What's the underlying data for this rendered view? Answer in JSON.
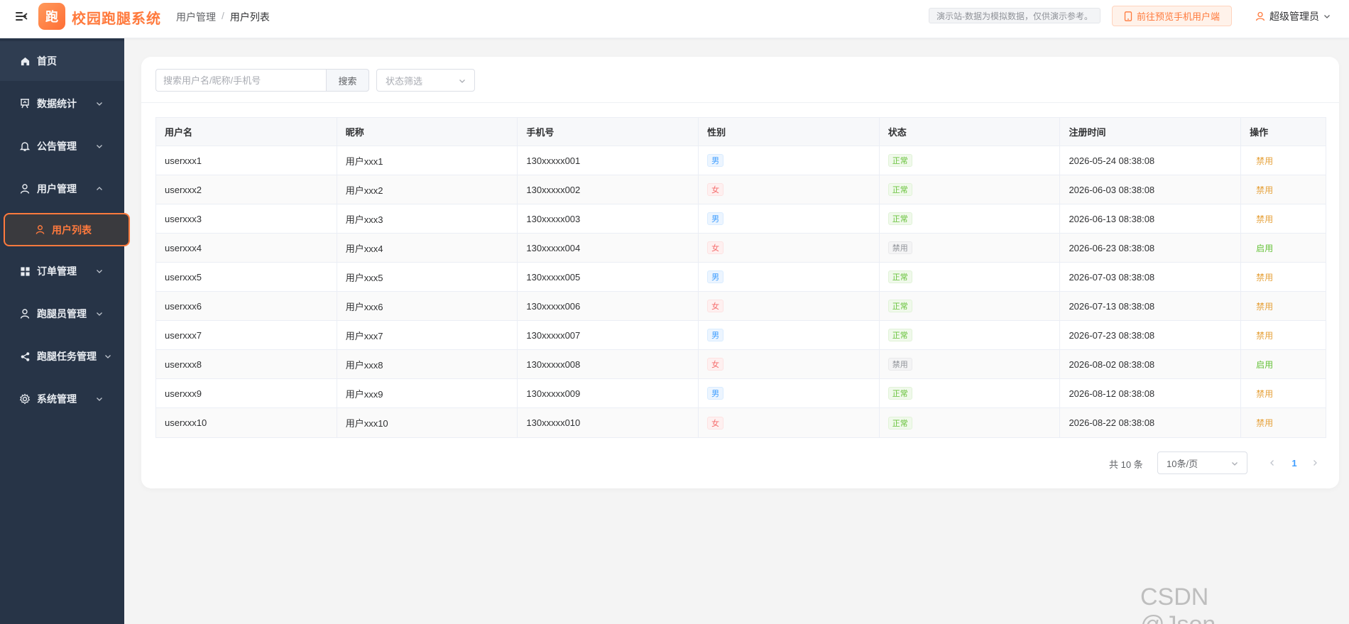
{
  "header": {
    "logo_char": "跑",
    "app_title": "校园跑腿系统",
    "breadcrumb": [
      "用户管理",
      "用户列表"
    ],
    "breadcrumb_sep": "/",
    "notice": "演示站-数据为模拟数据，仅供演示参考。",
    "preview_button": "前往预览手机用户端",
    "user_label": "超级管理员"
  },
  "sidebar": {
    "items": [
      {
        "label": "首页",
        "icon": "home-icon"
      },
      {
        "label": "数据统计",
        "icon": "chart-board-icon"
      },
      {
        "label": "公告管理",
        "icon": "bell-icon"
      },
      {
        "label": "用户管理",
        "icon": "user-icon"
      },
      {
        "label": "订单管理",
        "icon": "grid-icon"
      },
      {
        "label": "跑腿员管理",
        "icon": "user-icon"
      },
      {
        "label": "跑腿任务管理",
        "icon": "share-icon"
      },
      {
        "label": "系统管理",
        "icon": "gear-icon"
      }
    ],
    "active_sub": {
      "label": "用户列表",
      "icon": "user-icon"
    }
  },
  "toolbar": {
    "search_placeholder": "搜索用户名/昵称/手机号",
    "search_button": "搜索",
    "status_placeholder": "状态筛选"
  },
  "table": {
    "columns": [
      "用户名",
      "昵称",
      "手机号",
      "性别",
      "状态",
      "注册时间",
      "操作"
    ],
    "rows": [
      {
        "username": "userxxx1",
        "nickname": "用户xxx1",
        "phone": "130xxxxx001",
        "gender": "男",
        "status": "正常",
        "registered": "2026-05-24 08:38:08",
        "action": "禁用"
      },
      {
        "username": "userxxx2",
        "nickname": "用户xxx2",
        "phone": "130xxxxx002",
        "gender": "女",
        "status": "正常",
        "registered": "2026-06-03 08:38:08",
        "action": "禁用"
      },
      {
        "username": "userxxx3",
        "nickname": "用户xxx3",
        "phone": "130xxxxx003",
        "gender": "男",
        "status": "正常",
        "registered": "2026-06-13 08:38:08",
        "action": "禁用"
      },
      {
        "username": "userxxx4",
        "nickname": "用户xxx4",
        "phone": "130xxxxx004",
        "gender": "女",
        "status": "禁用",
        "registered": "2026-06-23 08:38:08",
        "action": "启用"
      },
      {
        "username": "userxxx5",
        "nickname": "用户xxx5",
        "phone": "130xxxxx005",
        "gender": "男",
        "status": "正常",
        "registered": "2026-07-03 08:38:08",
        "action": "禁用"
      },
      {
        "username": "userxxx6",
        "nickname": "用户xxx6",
        "phone": "130xxxxx006",
        "gender": "女",
        "status": "正常",
        "registered": "2026-07-13 08:38:08",
        "action": "禁用"
      },
      {
        "username": "userxxx7",
        "nickname": "用户xxx7",
        "phone": "130xxxxx007",
        "gender": "男",
        "status": "正常",
        "registered": "2026-07-23 08:38:08",
        "action": "禁用"
      },
      {
        "username": "userxxx8",
        "nickname": "用户xxx8",
        "phone": "130xxxxx008",
        "gender": "女",
        "status": "禁用",
        "registered": "2026-08-02 08:38:08",
        "action": "启用"
      },
      {
        "username": "userxxx9",
        "nickname": "用户xxx9",
        "phone": "130xxxxx009",
        "gender": "男",
        "status": "正常",
        "registered": "2026-08-12 08:38:08",
        "action": "禁用"
      },
      {
        "username": "userxxx10",
        "nickname": "用户xxx10",
        "phone": "130xxxxx010",
        "gender": "女",
        "status": "正常",
        "registered": "2026-08-22 08:38:08",
        "action": "禁用"
      }
    ]
  },
  "pagination": {
    "total": "共 10 条",
    "page_size": "10条/页",
    "current_page": "1"
  },
  "watermark": "CSDN @Json_____",
  "colors": {
    "accent": "#ff7a3d",
    "sidebar_bg": "#273447",
    "male_tag": "#409eff",
    "female_tag": "#f56c6c",
    "status_ok": "#67c23a",
    "status_off": "#909399",
    "action_disable": "#e6a23c",
    "action_enable": "#67c23a"
  }
}
